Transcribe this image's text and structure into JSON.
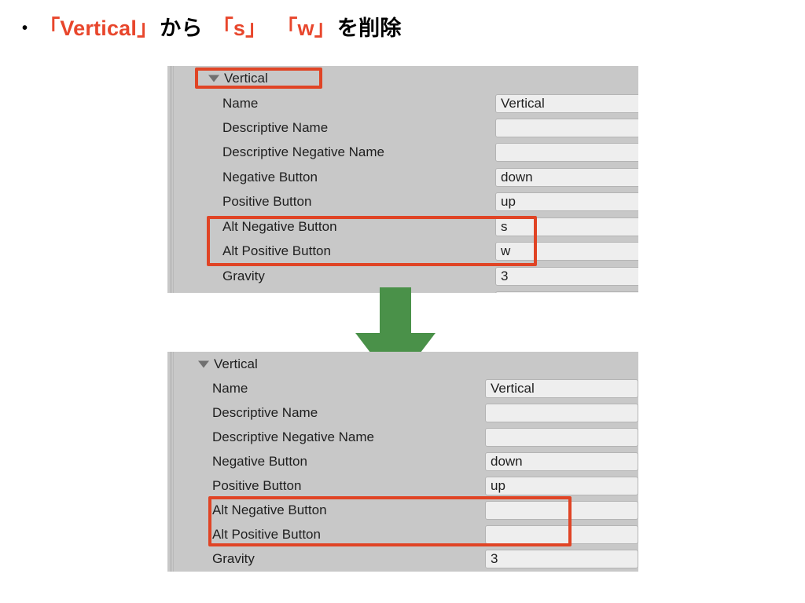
{
  "slide": {
    "bullet": "•",
    "title_parts": [
      {
        "text": "「Vertical」",
        "highlight": true
      },
      {
        "text": "から",
        "highlight": false
      },
      {
        "text": "「s」",
        "highlight": true
      },
      {
        "text": "「w」",
        "highlight": true
      },
      {
        "text": "を削除",
        "highlight": false
      }
    ],
    "title_plain": "「Vertical」 から 「s」 「w」 を削除"
  },
  "colors": {
    "highlight_red": "#e04425",
    "title_red": "#e8462c",
    "arrow_green": "#4a9149",
    "panel_bg": "#c8c8c8",
    "field_bg": "#eeeeee"
  },
  "panels": [
    {
      "id": "before",
      "foldout_label": "Vertical",
      "foldout_icon": "triangle-down-icon",
      "foldout_highlighted": true,
      "rows": [
        {
          "label": "Name",
          "value": "Vertical",
          "highlighted": false
        },
        {
          "label": "Descriptive Name",
          "value": "",
          "highlighted": false
        },
        {
          "label": "Descriptive Negative Name",
          "value": "",
          "highlighted": false
        },
        {
          "label": "Negative Button",
          "value": "down",
          "highlighted": false
        },
        {
          "label": "Positive Button",
          "value": "up",
          "highlighted": false
        },
        {
          "label": "Alt Negative Button",
          "value": "s",
          "highlighted": true
        },
        {
          "label": "Alt Positive Button",
          "value": "w",
          "highlighted": true
        },
        {
          "label": "Gravity",
          "value": "3",
          "highlighted": false
        }
      ]
    },
    {
      "id": "after",
      "foldout_label": "Vertical",
      "foldout_icon": "triangle-down-icon",
      "foldout_highlighted": false,
      "rows": [
        {
          "label": "Name",
          "value": "Vertical",
          "highlighted": false
        },
        {
          "label": "Descriptive Name",
          "value": "",
          "highlighted": false
        },
        {
          "label": "Descriptive Negative Name",
          "value": "",
          "highlighted": false
        },
        {
          "label": "Negative Button",
          "value": "down",
          "highlighted": false
        },
        {
          "label": "Positive Button",
          "value": "up",
          "highlighted": false
        },
        {
          "label": "Alt Negative Button",
          "value": "",
          "highlighted": true
        },
        {
          "label": "Alt Positive Button",
          "value": "",
          "highlighted": true
        },
        {
          "label": "Gravity",
          "value": "3",
          "highlighted": false
        }
      ]
    }
  ],
  "arrow": {
    "icon": "arrow-down-icon",
    "direction": "down"
  }
}
